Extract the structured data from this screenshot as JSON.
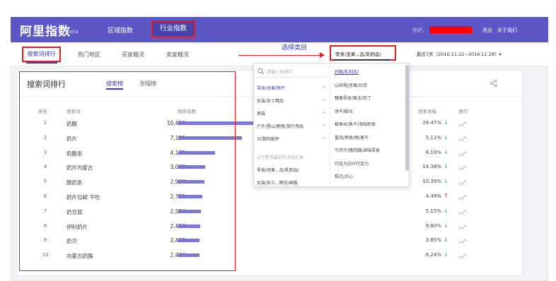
{
  "header": {
    "logo": "阿里指数",
    "logo_beta": "beta",
    "nav": [
      "区域指数",
      "行业指数"
    ],
    "active_nav": "行业指数",
    "greeting": "你好，",
    "logout": "退出",
    "about": "关于我们",
    "bg_color": "#5b57c4"
  },
  "subnav": {
    "tabs": [
      "搜索词排行",
      "热门地区",
      "买家概况",
      "卖家概况"
    ],
    "active_tab": "搜索词排行",
    "annotation": "选择类目",
    "category_select": "零食/坚果...品/乳制品/",
    "date_range": "最近7天（2016.11.22~2016.11.28）▾"
  },
  "card": {
    "title": "搜索词排行",
    "tab_search": "搜索榜",
    "tab_rise": "涨幅榜",
    "columns": {
      "rank": "排名",
      "keyword": "搜索词",
      "index": "搜索指数",
      "change": "搜索涨幅",
      "action": "操作"
    },
    "rows": [
      {
        "rank": "1",
        "keyword": "奶酪",
        "index": "10,409",
        "value": 10409,
        "change": "28.47%",
        "trend": "down"
      },
      {
        "rank": "2",
        "keyword": "奶片",
        "index": "7,195",
        "value": 7195,
        "change": "5.11%",
        "trend": "down"
      },
      {
        "rank": "3",
        "keyword": "奶酪条",
        "index": "4,141",
        "value": 4141,
        "change": "8.18%",
        "trend": "down"
      },
      {
        "rank": "4",
        "keyword": "奶片内蒙古",
        "index": "3,062",
        "value": 3062,
        "change": "14.38%",
        "trend": "down"
      },
      {
        "rank": "5",
        "keyword": "酸奶条",
        "index": "2,946",
        "value": 2946,
        "change": "10.39%",
        "trend": "down"
      },
      {
        "rank": "6",
        "keyword": "奶片包邮 干吃",
        "index": "2,701",
        "value": 2701,
        "change": "4.49%",
        "trend": "up"
      },
      {
        "rank": "7",
        "keyword": "奶豆腐",
        "index": "2,534",
        "value": 2534,
        "change": "5.15%",
        "trend": "down"
      },
      {
        "rank": "8",
        "keyword": "伊利奶片",
        "index": "2,496",
        "value": 2496,
        "change": "9.80%",
        "trend": "down"
      },
      {
        "rank": "9",
        "keyword": "奶贝",
        "index": "2,405",
        "value": 2405,
        "change": "3.85%",
        "trend": "down"
      },
      {
        "rank": "10",
        "keyword": "内蒙古奶酪",
        "index": "2,404",
        "value": 2404,
        "change": "6.24%",
        "trend": "down"
      }
    ],
    "bar_max": 10409,
    "colors": {
      "bar": "#7b77d6",
      "down": "#3cb371",
      "up": "#e02020",
      "accent": "#3c38b8"
    }
  },
  "dropdown": {
    "search_placeholder": "请输入关键字",
    "left_items": [
      {
        "label": "零食/坚果/特产",
        "active": true,
        "has_children": true
      },
      {
        "label": "女装/女士精品",
        "active": false,
        "has_children": true
      },
      {
        "label": "男装",
        "active": false,
        "has_children": true
      },
      {
        "label": "户外/登山/野营/旅行用品",
        "active": false,
        "has_children": true
      },
      {
        "label": "3C数码配件",
        "active": false,
        "has_children": true
      }
    ],
    "history_label": "以下是您最近的浏览记录",
    "history_items": [
      "零食/坚果...品/乳制品/",
      "女装/女士...精衣/棉服"
    ],
    "right_items": [
      {
        "label": "奶酪/乳制品/",
        "active": true
      },
      {
        "label": "山核桃/坚果/炒货",
        "active": false
      },
      {
        "label": "糖果零食/果冻/布丁",
        "active": false
      },
      {
        "label": "饼干/膨化",
        "active": false
      },
      {
        "label": "鱿鱼丝/鱼干/海味即食",
        "active": false
      },
      {
        "label": "蜜饯/枣类/梅/果干",
        "active": false
      },
      {
        "label": "牛肉干/猪肉脯/卤味零食",
        "active": false
      },
      {
        "label": "巧克力/DIY巧克力",
        "active": false
      },
      {
        "label": "糕点/点心",
        "active": false
      }
    ]
  }
}
